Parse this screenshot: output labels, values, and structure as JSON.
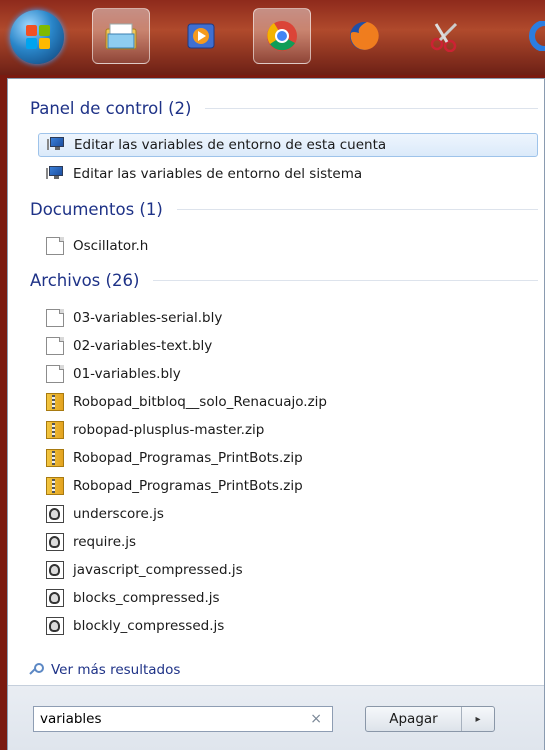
{
  "taskbar": {
    "icons": [
      "windows-orb",
      "file-explorer-icon",
      "media-player-icon",
      "chrome-icon",
      "firefox-icon",
      "snipping-tool-icon",
      "app-icon"
    ]
  },
  "sections": [
    {
      "title": "Panel de control (2)",
      "items": [
        {
          "label": "Editar las variables de entorno de esta cuenta",
          "icon": "control-panel-icon",
          "selected": true
        },
        {
          "label": "Editar las variables de entorno del sistema",
          "icon": "control-panel-icon",
          "selected": false
        }
      ]
    },
    {
      "title": "Documentos (1)",
      "items": [
        {
          "label": "Oscillator.h",
          "icon": "file-icon"
        }
      ]
    },
    {
      "title": "Archivos (26)",
      "items": [
        {
          "label": "03-variables-serial.bly",
          "icon": "file-icon"
        },
        {
          "label": "02-variables-text.bly",
          "icon": "file-icon"
        },
        {
          "label": "01-variables.bly",
          "icon": "file-icon"
        },
        {
          "label": "Robopad_bitbloq__solo_Renacuajo.zip",
          "icon": "zip-icon"
        },
        {
          "label": "robopad-plusplus-master.zip",
          "icon": "zip-icon"
        },
        {
          "label": "Robopad_Programas_PrintBots.zip",
          "icon": "zip-icon"
        },
        {
          "label": "Robopad_Programas_PrintBots.zip",
          "icon": "zip-icon"
        },
        {
          "label": "underscore.js",
          "icon": "script-icon"
        },
        {
          "label": "require.js",
          "icon": "script-icon"
        },
        {
          "label": "javascript_compressed.js",
          "icon": "script-icon"
        },
        {
          "label": "blocks_compressed.js",
          "icon": "script-icon"
        },
        {
          "label": "blockly_compressed.js",
          "icon": "script-icon"
        }
      ]
    }
  ],
  "more_results": "Ver más resultados",
  "search": {
    "value": "variables",
    "clear": "×"
  },
  "shutdown": {
    "label": "Apagar",
    "arrow": "▸"
  },
  "colors": {
    "heading": "#1e3287",
    "selection": "#dbeafa",
    "taskbar": "#8e2a1c"
  }
}
